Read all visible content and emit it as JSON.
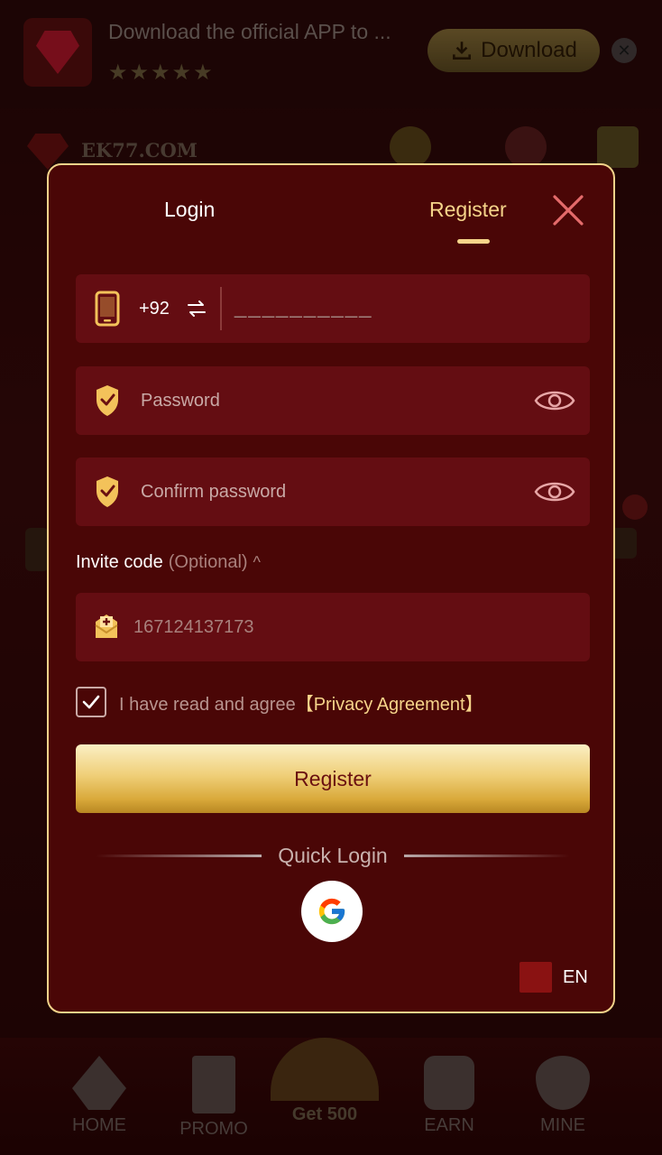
{
  "banner": {
    "title": "Download the official APP to ...",
    "stars": "★★★★★",
    "download_label": "Download",
    "close_glyph": "✕"
  },
  "header": {
    "domain": "EK77.COM"
  },
  "modal": {
    "tabs": {
      "login": "Login",
      "register": "Register"
    },
    "active_tab": "Register",
    "phone": {
      "country_code": "+92",
      "placeholder": "__________"
    },
    "password": {
      "placeholder": "Password"
    },
    "confirm_password": {
      "placeholder": "Confirm password"
    },
    "invite": {
      "label": "Invite code",
      "optional": "(Optional)",
      "caret": "^",
      "value": "167124137173"
    },
    "agreement": {
      "checked": true,
      "text": "I have read and agree",
      "link": "【Privacy Agreement】"
    },
    "submit_label": "Register",
    "quick_login_label": "Quick Login",
    "language": "EN"
  },
  "bottom_nav": {
    "home": "HOME",
    "promo": "PROMO",
    "get": "Get 500",
    "earn": "EARN",
    "mine": "MINE"
  },
  "colors": {
    "accent_gold": "#f6d48a",
    "modal_bg": "#4a0606",
    "field_bg": "#640d12",
    "close_x": "#e46b6b"
  },
  "icons": {
    "phone": "phone-icon",
    "swap": "swap-arrows-icon",
    "shield": "shield-check-icon",
    "eye": "eye-icon",
    "invite": "envelope-plus-icon",
    "google": "google-icon",
    "close": "close-icon"
  }
}
